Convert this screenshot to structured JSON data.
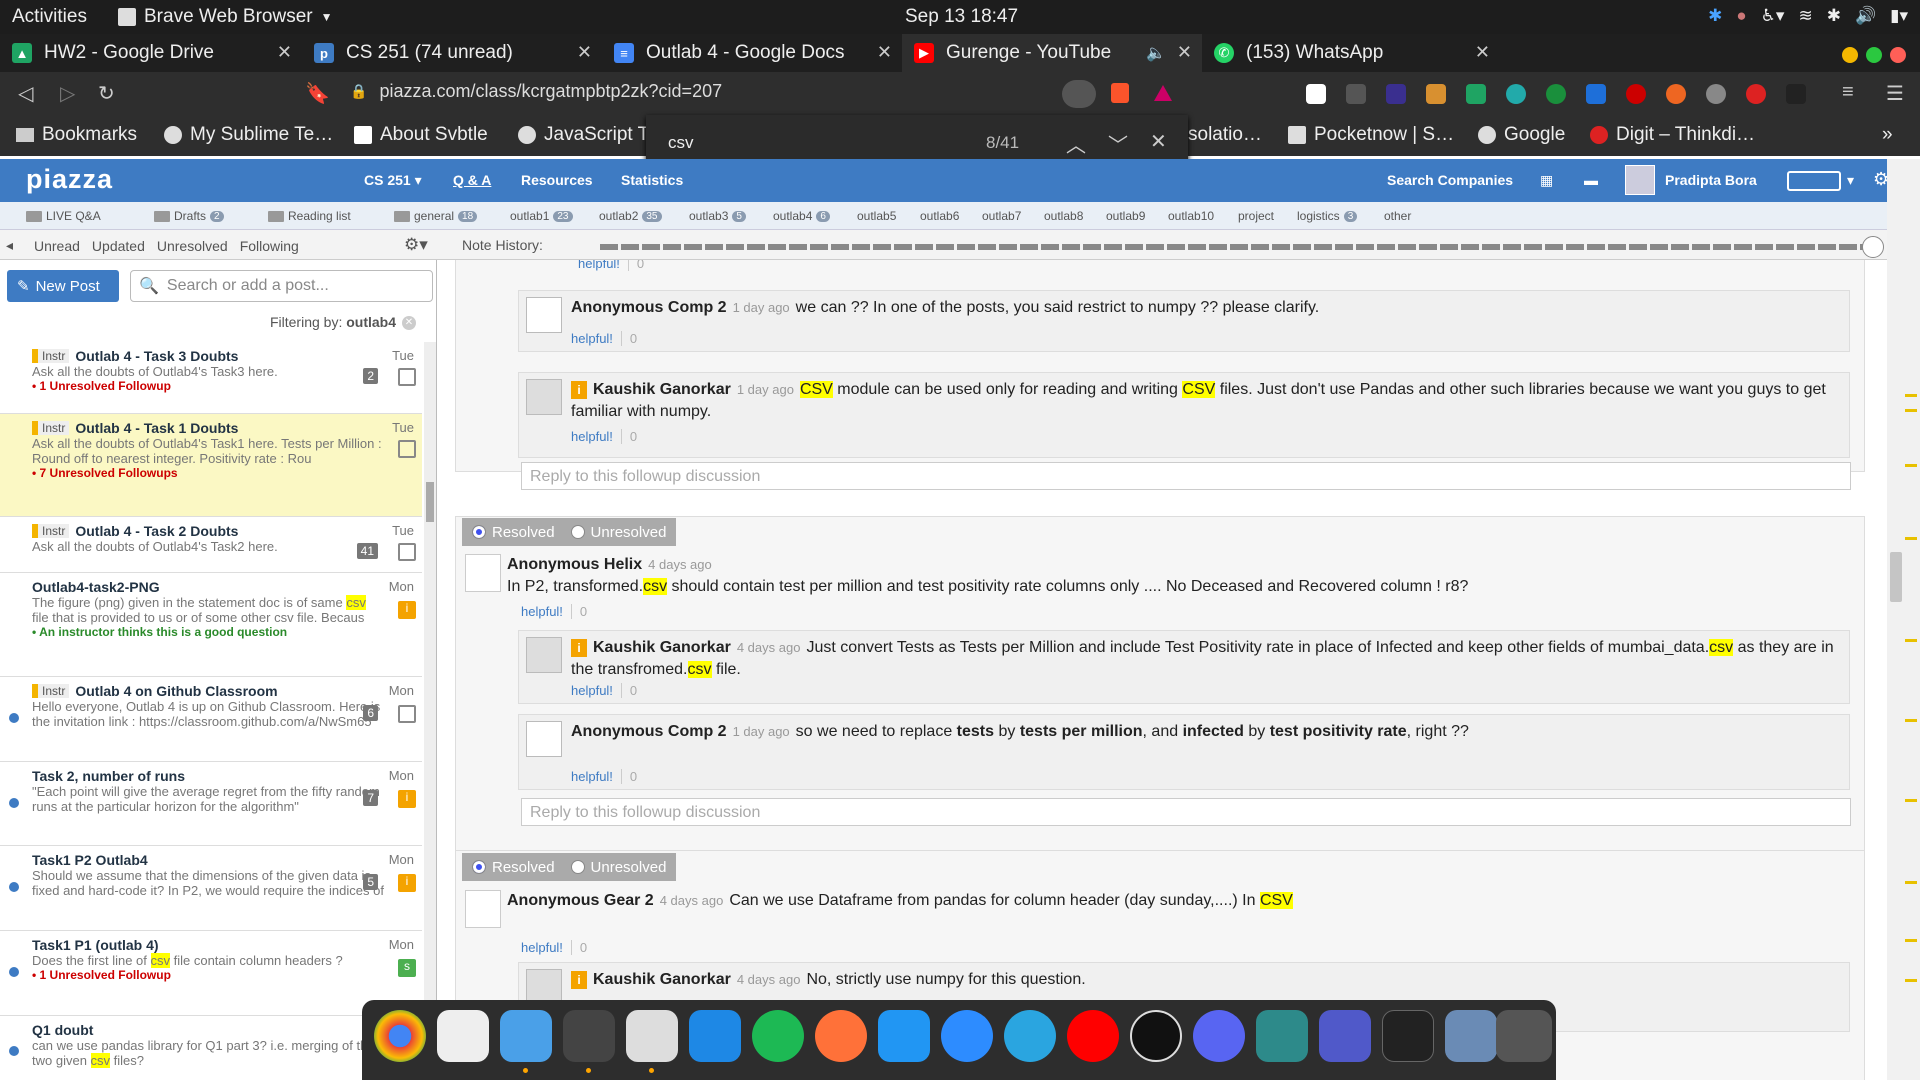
{
  "gnome": {
    "activities": "Activities",
    "app": "Brave Web Browser",
    "clock": "Sep 13  18:47"
  },
  "tabs": [
    {
      "title": "HW2 - Google Drive",
      "icon": "google-drive-icon"
    },
    {
      "title": "CS 251 (74 unread)",
      "icon": "piazza-icon"
    },
    {
      "title": "Outlab 4 - Google Docs",
      "icon": "google-docs-icon"
    },
    {
      "title": "Gurenge - YouTube",
      "icon": "youtube-icon"
    },
    {
      "title": "(153) WhatsApp",
      "icon": "whatsapp-icon"
    }
  ],
  "url": "piazza.com/class/kcrgatmpbtp2zk?cid=207",
  "bookmarks": [
    "Bookmarks",
    "My Sublime Te…",
    "About Svbtle",
    "JavaScript T",
    "solatio…",
    "Pocketnow | S…",
    "Google",
    "Digit – Thinkdi…"
  ],
  "find": {
    "query": "csv",
    "count": "8/41"
  },
  "piazza": {
    "logo": "piazza",
    "course": "CS 251",
    "nav": [
      "Q & A",
      "Resources",
      "Statistics"
    ],
    "search_companies": "Search Companies",
    "user": "Pradipta Bora"
  },
  "folders": [
    {
      "name": "LIVE Q&A",
      "badge": ""
    },
    {
      "name": "Drafts",
      "badge": "2"
    },
    {
      "name": "Reading list",
      "badge": ""
    },
    {
      "name": "general",
      "badge": "18"
    },
    {
      "name": "outlab1",
      "badge": "23"
    },
    {
      "name": "outlab2",
      "badge": "35"
    },
    {
      "name": "outlab3",
      "badge": "5"
    },
    {
      "name": "outlab4",
      "badge": "6"
    },
    {
      "name": "outlab5",
      "badge": ""
    },
    {
      "name": "outlab6",
      "badge": ""
    },
    {
      "name": "outlab7",
      "badge": ""
    },
    {
      "name": "outlab8",
      "badge": ""
    },
    {
      "name": "outlab9",
      "badge": ""
    },
    {
      "name": "outlab10",
      "badge": ""
    },
    {
      "name": "project",
      "badge": ""
    },
    {
      "name": "logistics",
      "badge": "3"
    },
    {
      "name": "other",
      "badge": ""
    }
  ],
  "filters": [
    "Unread",
    "Updated",
    "Unresolved",
    "Following"
  ],
  "note_history": "Note History:",
  "sidebar": {
    "new_post": "New Post",
    "search_placeholder": "Search or add a post...",
    "filtering": "Filtering by: ",
    "filter_value": "outlab4"
  },
  "posts": [
    {
      "tag": "Instr",
      "title": "Outlab 4 - Task 3 Doubts",
      "date": "Tue",
      "count": "2",
      "pre": "Ask all the doubts of Outlab4's Task3 here.",
      "hl": "",
      "post": "",
      "note": "1 Unresolved Followup"
    },
    {
      "tag": "Instr",
      "title": "Outlab 4 - Task 1 Doubts",
      "date": "Tue",
      "count": "",
      "pre": "Ask all the doubts of Outlab4's Task1 here. Tests per Million : Round off to nearest integer. Positivity rate : Rou",
      "hl": "",
      "post": "",
      "note": "7 Unresolved Followups"
    },
    {
      "tag": "Instr",
      "title": "Outlab 4 - Task 2 Doubts",
      "date": "Tue",
      "count": "41",
      "pre": "Ask all the doubts of Outlab4's Task2 here.",
      "hl": "",
      "post": "",
      "note": ""
    },
    {
      "tag": "",
      "title": "Outlab4-task2-PNG",
      "date": "Mon",
      "count": "",
      "pre": "The figure (png) given in the statement doc is of same ",
      "hl": "csv",
      "post": " file that is provided to us or of some other csv file. Becaus",
      "note": "An instructor thinks this is a good question"
    },
    {
      "tag": "Instr",
      "title": "Outlab 4 on Github Classroom",
      "date": "Mon",
      "count": "6",
      "pre": "Hello everyone, Outlab 4 is up on Github Classroom. Here is the invitation link : https://classroom.github.com/a/NwSm65",
      "hl": "",
      "post": "",
      "note": ""
    },
    {
      "tag": "",
      "title": "Task 2, number of runs",
      "date": "Mon",
      "count": "7",
      "pre": "\"Each point will give the average regret from the fifty random runs at the particular horizon for the algorithm\"",
      "hl": "",
      "post": "",
      "note": ""
    },
    {
      "tag": "",
      "title": "Task1 P2 Outlab4",
      "date": "Mon",
      "count": "5",
      "pre": "Should we assume that the dimensions of the given data is fixed and hard-code it? In P2, we would require the indices of",
      "hl": "",
      "post": "",
      "note": ""
    },
    {
      "tag": "",
      "title": "Task1 P1 (outlab 4)",
      "date": "Mon",
      "count": "",
      "pre": "Does the first line of ",
      "hl": "csv",
      "post": " file contain column headers ?",
      "note": "1 Unresolved Followup"
    },
    {
      "tag": "",
      "title": "Q1 doubt",
      "date": "",
      "count": "",
      "pre": "can we use pandas library for Q1 part 3? i.e. merging of the two given ",
      "hl": "csv",
      "post": " files?",
      "note": ""
    }
  ],
  "thread": {
    "helpful": "helpful!",
    "zero": "0",
    "reply_placeholder": "Reply to this followup discussion",
    "resolved": "Resolved",
    "unresolved": "Unresolved",
    "f1_r1": {
      "name": "Anonymous Comp 2",
      "time": "1 day ago",
      "text": "we can ?? In one of the posts, you said restrict to numpy ?? please clarify."
    },
    "f1_r2": {
      "name": "Kaushik Ganorkar",
      "time": "1 day ago",
      "hl1": "CSV",
      "a": " module can be used only for reading and writing ",
      "hl2": "CSV",
      "b": " files. Just don't use Pandas and other such libraries because we want you guys to get familiar with numpy."
    },
    "f2": {
      "name": "Anonymous Helix",
      "time": "4 days ago",
      "a": "In P2, transformed.",
      "hl": "csv",
      "b": " should contain test per million and test positivity rate columns only .... No Deceased and Recovered column ! r8?"
    },
    "f2_r1": {
      "name": "Kaushik Ganorkar",
      "time": "4 days ago",
      "a": "Just convert Tests as Tests per Million and include Test Positivity rate in place of Infected and keep other fields of mumbai_data.",
      "hl1": "csv",
      "b": " as they are in the transfromed.",
      "hl2": "csv",
      "c": " file."
    },
    "f2_r2": {
      "name": "Anonymous Comp 2",
      "time": "1 day ago",
      "a": "so we need to replace ",
      "b1": "tests",
      "c": " by ",
      "b2": "tests per million",
      "d": ", and ",
      "b3": "infected",
      "e": " by ",
      "b4": "test positivity rate",
      "f": ", right ??"
    },
    "f3": {
      "name": "Anonymous Gear 2",
      "time": "4 days ago",
      "a": "Can we use Dataframe from pandas for column header (day sunday,....) In ",
      "hl": "CSV"
    },
    "f3_r1": {
      "name": "Kaushik Ganorkar",
      "time": "4 days ago",
      "text": "No, strictly use numpy for this question."
    }
  },
  "dock": [
    "chrome-icon",
    "text-editor-icon",
    "finder-icon",
    "sublime-text-icon",
    "brave-icon",
    "vscode-icon",
    "spotify-icon",
    "firefox-icon",
    "app-store-icon",
    "zoom-icon",
    "telegram-icon",
    "youtube-music-icon",
    "media-player-icon",
    "discord-icon",
    "matlab-icon",
    "teams-icon",
    "terminal-icon",
    "image-viewer-icon",
    "screenshot-icon"
  ],
  "colors": {
    "piazza_blue": "#3e7bc3",
    "highlight": "#ffff00",
    "instructor_badge": "#f4a300",
    "unresolved_red": "#cc0000"
  }
}
